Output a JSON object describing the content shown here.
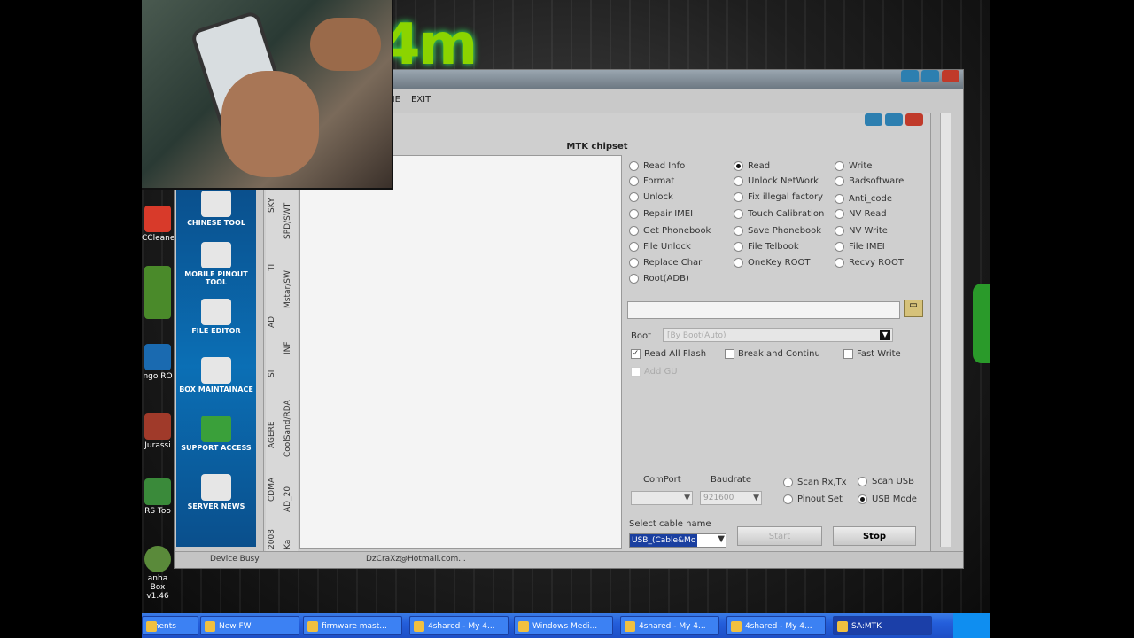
{
  "background": {
    "logo_text": "4m"
  },
  "desktop_icons": [
    {
      "label": "CCleane",
      "color": "#d83a2a"
    },
    {
      "label": "",
      "color": "#4a8a2a"
    },
    {
      "label": "ngo RO",
      "color": "#1a6ab0"
    },
    {
      "label": "Jurassi",
      "color": "#a03a2a"
    },
    {
      "label": "RS Too",
      "color": "#3a8a3a"
    },
    {
      "label": "anha Box v1.46",
      "color": "#5a8a3a"
    }
  ],
  "menu": {
    "item1": "ME",
    "item2": "EXIT"
  },
  "header": {
    "chipset": "MTK chipset"
  },
  "sidebar": [
    {
      "label": "CHINESE TOOL"
    },
    {
      "label": "MOBILE PINOUT TOOL"
    },
    {
      "label": "FILE EDITOR"
    },
    {
      "label": "BOX MAINTAINACE"
    },
    {
      "label": "SUPPORT ACCESS"
    },
    {
      "label": "SERVER NEWS"
    }
  ],
  "vtabs_left": [
    "SKY",
    "TI",
    "ADI",
    "SI",
    "AGERE",
    "CDMA",
    "2008"
  ],
  "vtabs_right": [
    "SPD/SWT",
    "Mstar/SW",
    "INF",
    "CoolSand/RDA",
    "AD_20",
    "Ka"
  ],
  "options": {
    "col1": [
      "Read Info",
      "Format",
      "Unlock",
      "Repair IMEI",
      "Get Phonebook",
      "File Unlock",
      "Replace Char",
      "Root(ADB)"
    ],
    "col2": [
      "Read",
      "Unlock NetWork",
      "Fix illegal factory",
      "Touch Calibration",
      "Save Phonebook",
      "File Telbook",
      "OneKey ROOT"
    ],
    "col3": [
      "Write",
      "Badsoftware",
      "Anti_code",
      "NV Read",
      "NV Write",
      "File IMEI",
      "Recvy ROOT"
    ],
    "selected": "Read"
  },
  "boot": {
    "label": "Boot",
    "value": "[By Boot(Auto)"
  },
  "checks": {
    "read_all_flash": "Read All Flash",
    "break_continue": "Break and Continu",
    "fast_write": "Fast Write",
    "add_gu": "Add GU"
  },
  "comport": {
    "label": "ComPort",
    "value": ""
  },
  "baudrate": {
    "label": "Baudrate",
    "value": "921600"
  },
  "scan": {
    "scan_rxtx": "Scan Rx,Tx",
    "scan_usb": "Scan USB",
    "pinout_set": "Pinout Set",
    "usb_mode": "USB Mode"
  },
  "cable": {
    "label": "Select cable name",
    "value": "USB_(Cable&Mo"
  },
  "buttons": {
    "start": "Start",
    "stop": "Stop"
  },
  "status": {
    "left": "Device Busy",
    "email": "DzCraXz@Hotmail.com..."
  },
  "taskbar": [
    {
      "label": "uments"
    },
    {
      "label": "New FW"
    },
    {
      "label": "firmware mast..."
    },
    {
      "label": "4shared - My 4..."
    },
    {
      "label": "Windows Medi..."
    },
    {
      "label": "4shared - My 4..."
    },
    {
      "label": "4shared - My 4..."
    },
    {
      "label": "SA:MTK"
    }
  ]
}
